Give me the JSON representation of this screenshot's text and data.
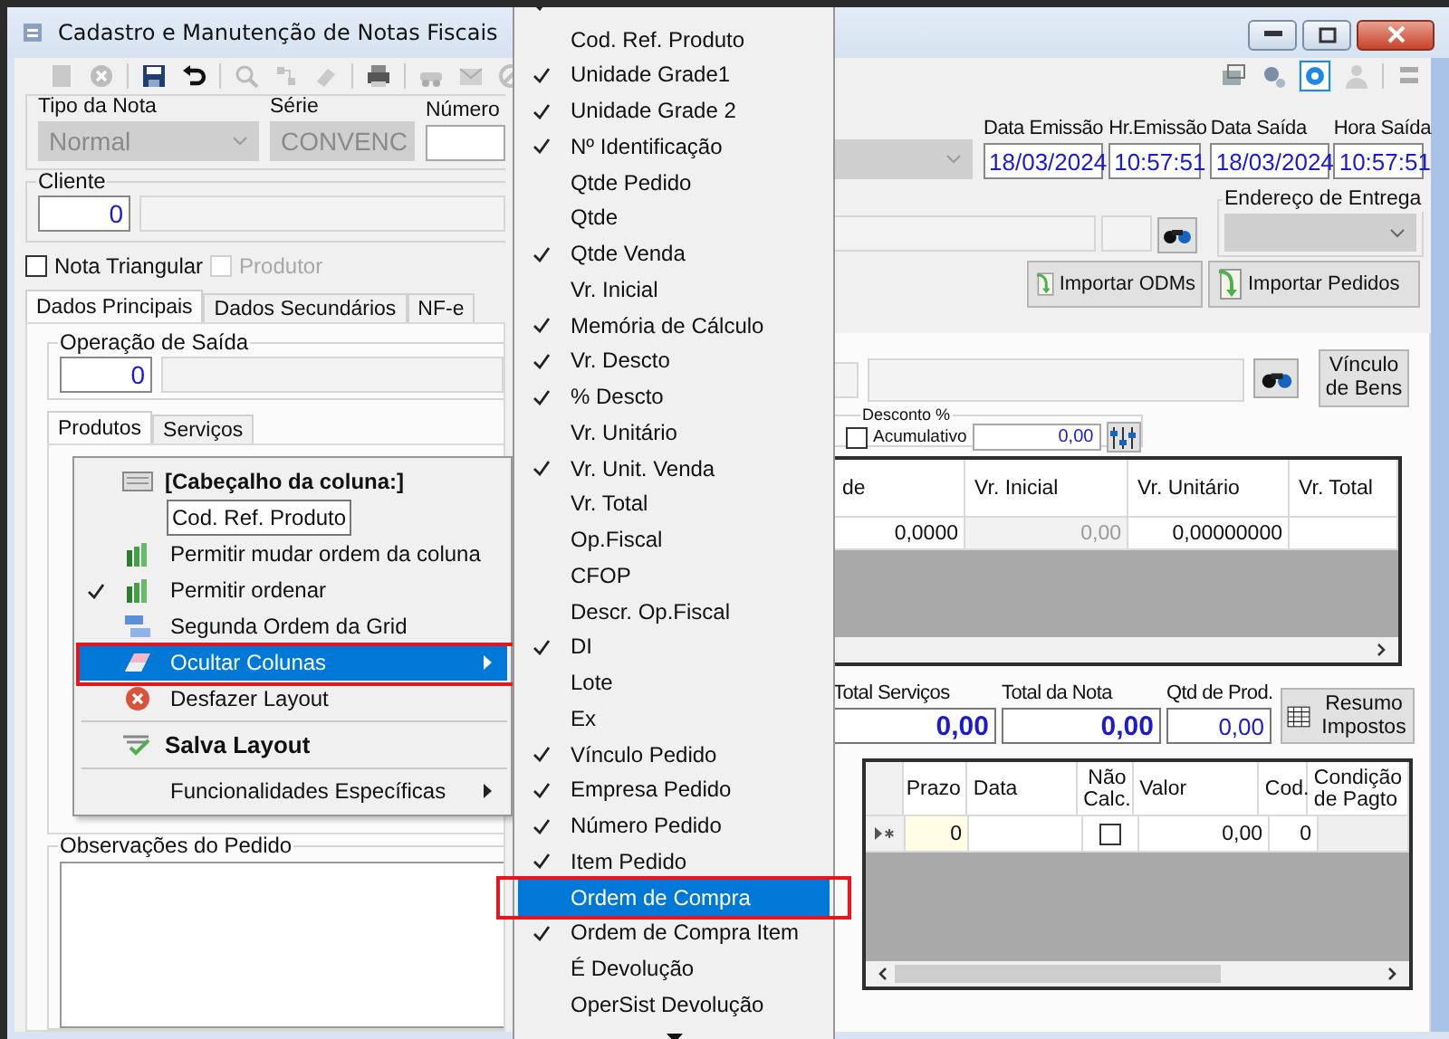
{
  "window": {
    "title": "Cadastro e Manutenção de Notas Fiscais"
  },
  "nota_fields": [
    {
      "label": "Tipo da Nota",
      "value": "Normal",
      "kind": "select",
      "disabled": true
    },
    {
      "label": "Série",
      "value": "CONVENC",
      "kind": "select",
      "disabled": true
    },
    {
      "label": "Número",
      "kind": "text",
      "disabled": false
    }
  ],
  "dates": [
    {
      "label": "Data Emissão",
      "value": "18/03/2024"
    },
    {
      "label": "Hr.Emissão",
      "value": "10:57:51"
    },
    {
      "label": "Data Saída",
      "value": "18/03/2024"
    },
    {
      "label": "Hora Saída",
      "value": "10:57:51"
    }
  ],
  "cliente": {
    "label": "Cliente",
    "code": "0"
  },
  "endereco_entrega": {
    "label": "Endereço de Entrega"
  },
  "options": [
    {
      "label": "Nota Triangular",
      "checked": false,
      "disabled": false
    },
    {
      "label": "Produtor",
      "checked": false,
      "disabled": true
    }
  ],
  "import_buttons": [
    "Importar ODMs",
    "Importar Pedidos"
  ],
  "tabs": [
    {
      "label": "Dados Principais",
      "selected": true
    },
    {
      "label": "Dados Secundários",
      "selected": false
    },
    {
      "label": "NF-e",
      "selected": false
    }
  ],
  "operacao_saida": {
    "label": "Operação de Saída",
    "code": "0"
  },
  "vinculo_button": "Vínculo de Bens",
  "desconto": {
    "label": "Desconto %",
    "option": {
      "label": "Acumulativo",
      "checked": false
    },
    "value": "0,00"
  },
  "item_tabs": [
    {
      "label": "Produtos",
      "selected": true
    },
    {
      "label": "Serviços",
      "selected": false
    }
  ],
  "products_grid": {
    "columns": [
      {
        "label": "de",
        "readonly": false
      },
      {
        "label": "Vr. Inicial",
        "readonly": true
      },
      {
        "label": "Vr. Unitário",
        "readonly": false
      },
      {
        "label": "Vr. Total",
        "readonly": false
      }
    ],
    "rows": [
      {
        "cells": [
          "0,0000",
          "0,00",
          "0,00000000"
        ]
      }
    ]
  },
  "totals": [
    {
      "label": "Total Serviços",
      "value": "0,00",
      "bold": true
    },
    {
      "label": "Total da Nota",
      "value": "0,00",
      "bold": true
    },
    {
      "label": "Qtd de Prod.",
      "value": "0,00",
      "bold": false
    }
  ],
  "resumo_button": "Resumo Impostos",
  "payment_grid": {
    "columns": [
      "Prazo",
      "Data",
      "Não Calc.",
      "Valor",
      "Cod.",
      "Condição de Pagto"
    ],
    "rows": [
      {
        "prazo": "0",
        "nao_calc": false,
        "valor": "0,00",
        "cod": "0"
      }
    ]
  },
  "observacoes": {
    "label": "Observações do Pedido"
  },
  "context_menu": {
    "items": [
      {
        "kind": "header",
        "label": "[Cabeçalho da coluna:]",
        "selected": false
      },
      {
        "kind": "field",
        "label": "Cod. Ref. Produto",
        "selected": false
      },
      {
        "kind": "bars",
        "label": "Permitir mudar ordem da coluna",
        "checked": false,
        "selected": false,
        "submenu": false,
        "annotated": false
      },
      {
        "kind": "bars",
        "label": "Permitir ordenar",
        "checked": true,
        "selected": false,
        "submenu": false,
        "annotated": false
      },
      {
        "kind": "stack",
        "label": "Segunda Ordem da Grid",
        "checked": false,
        "selected": false,
        "submenu": false,
        "annotated": false
      },
      {
        "kind": "eraser",
        "label": "Ocultar Colunas",
        "checked": false,
        "selected": true,
        "submenu": true,
        "annotated": true
      },
      {
        "kind": "cancel",
        "label": "Desfazer Layout",
        "checked": false,
        "selected": false,
        "submenu": false,
        "annotated": false
      },
      {
        "kind": "separator"
      },
      {
        "kind": "save",
        "label": "Salva Layout",
        "checked": false,
        "selected": false,
        "submenu": false,
        "annotated": false
      },
      {
        "kind": "separator"
      },
      {
        "kind": "plain",
        "label": "Funcionalidades Específicas",
        "checked": false,
        "selected": false,
        "submenu": true,
        "annotated": false
      }
    ]
  },
  "column_menu": {
    "items": [
      {
        "checked": true,
        "selected": false,
        "annotated": false
      },
      {
        "label": "Cod. Ref. Produto",
        "checked": false,
        "selected": false,
        "annotated": false
      },
      {
        "label": "Unidade Grade1",
        "checked": true,
        "selected": false,
        "annotated": false
      },
      {
        "label": "Unidade Grade 2",
        "checked": true,
        "selected": false,
        "annotated": false
      },
      {
        "label": "Nº Identificação",
        "checked": true,
        "selected": false,
        "annotated": false
      },
      {
        "label": "Qtde Pedido",
        "checked": false,
        "selected": false,
        "annotated": false
      },
      {
        "label": "Qtde",
        "checked": false,
        "selected": false,
        "annotated": false
      },
      {
        "label": "Qtde Venda",
        "checked": true,
        "selected": false,
        "annotated": false
      },
      {
        "label": "Vr. Inicial",
        "checked": false,
        "selected": false,
        "annotated": false
      },
      {
        "label": "Memória de Cálculo",
        "checked": true,
        "selected": false,
        "annotated": false
      },
      {
        "label": "Vr. Descto",
        "checked": true,
        "selected": false,
        "annotated": false
      },
      {
        "label": "% Descto",
        "checked": true,
        "selected": false,
        "annotated": false
      },
      {
        "label": "Vr. Unitário",
        "checked": false,
        "selected": false,
        "annotated": false
      },
      {
        "label": "Vr. Unit. Venda",
        "checked": true,
        "selected": false,
        "annotated": false
      },
      {
        "label": "Vr. Total",
        "checked": false,
        "selected": false,
        "annotated": false
      },
      {
        "label": "Op.Fiscal",
        "checked": false,
        "selected": false,
        "annotated": false
      },
      {
        "label": "CFOP",
        "checked": false,
        "selected": false,
        "annotated": false
      },
      {
        "label": "Descr. Op.Fiscal",
        "checked": false,
        "selected": false,
        "annotated": false
      },
      {
        "label": "DI",
        "checked": true,
        "selected": false,
        "annotated": false
      },
      {
        "label": "Lote",
        "checked": false,
        "selected": false,
        "annotated": false
      },
      {
        "label": "Ex",
        "checked": false,
        "selected": false,
        "annotated": false
      },
      {
        "label": "Vínculo Pedido",
        "checked": true,
        "selected": false,
        "annotated": false
      },
      {
        "label": "Empresa Pedido",
        "checked": true,
        "selected": false,
        "annotated": false
      },
      {
        "label": "Número Pedido",
        "checked": true,
        "selected": false,
        "annotated": false
      },
      {
        "label": "Item Pedido",
        "checked": true,
        "selected": false,
        "annotated": false
      },
      {
        "label": "Ordem de Compra",
        "checked": false,
        "selected": true,
        "annotated": true
      },
      {
        "label": "Ordem de Compra Item",
        "checked": true,
        "selected": false,
        "annotated": false
      },
      {
        "label": "É Devolução",
        "checked": false,
        "selected": false,
        "annotated": false
      },
      {
        "label": "OperSist Devolução",
        "checked": false,
        "selected": false,
        "annotated": false
      }
    ]
  }
}
